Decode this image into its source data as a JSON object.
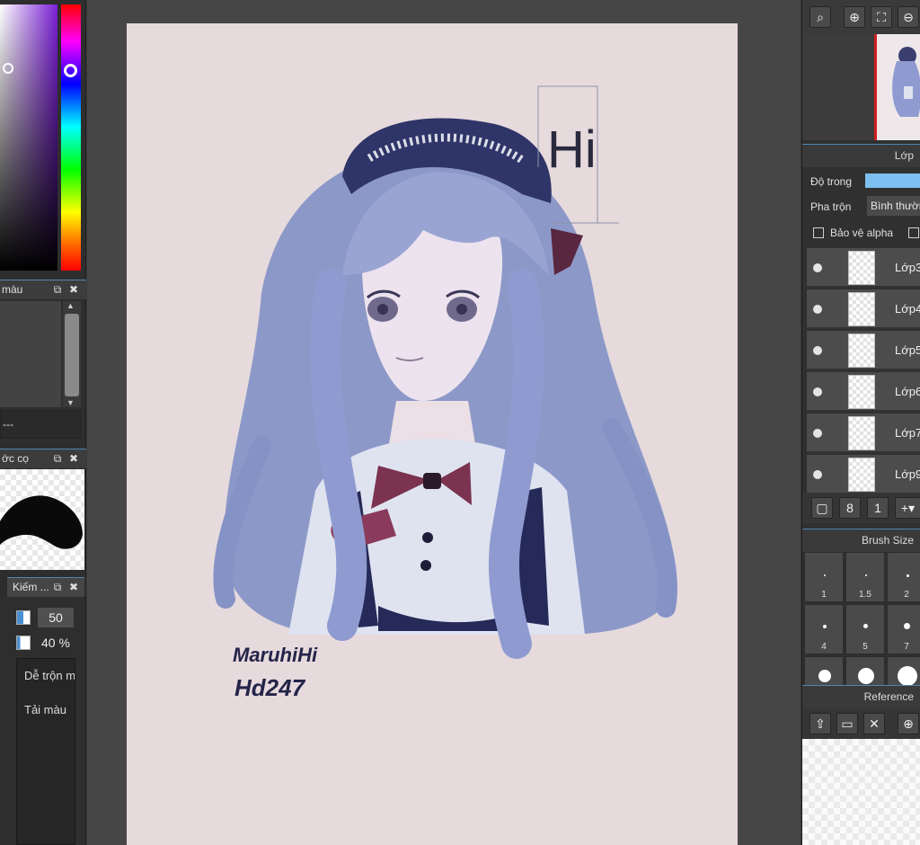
{
  "left_panel": {
    "color_list_title": "màu",
    "color_list_placeholder": "---",
    "brush_shape_title": "ớc cọ",
    "tool_tab_label": "Kiếm ...",
    "size_value": "50",
    "opacity_value": "40 %",
    "blend_modes": [
      "Dễ trộn màu",
      "Tải màu"
    ]
  },
  "canvas": {
    "paper_color": "#e6dadd",
    "sign_text": "Hi",
    "signature_line1": "MaruhiHi",
    "signature_line2": "Hd247"
  },
  "right_panel": {
    "layer_section_title": "Lớp",
    "opacity_label": "Độ trong",
    "blend_label": "Pha trộn",
    "blend_value": "Bình thường",
    "protect_alpha_label": "Bảo vệ alpha",
    "layers": [
      {
        "name": "Lớp3"
      },
      {
        "name": "Lớp4"
      },
      {
        "name": "Lớp5"
      },
      {
        "name": "Lớp6"
      },
      {
        "name": "Lớp7"
      },
      {
        "name": "Lớp9"
      }
    ],
    "brush_size_title": "Brush Size",
    "brush_sizes": [
      "1",
      "1.5",
      "2",
      "4",
      "5",
      "7",
      "",
      "",
      ""
    ],
    "reference_title": "Reference"
  },
  "colors": {
    "accent": "#4f86b3",
    "panel_bg": "#2e2e2e",
    "nav_border": "#d02020"
  }
}
